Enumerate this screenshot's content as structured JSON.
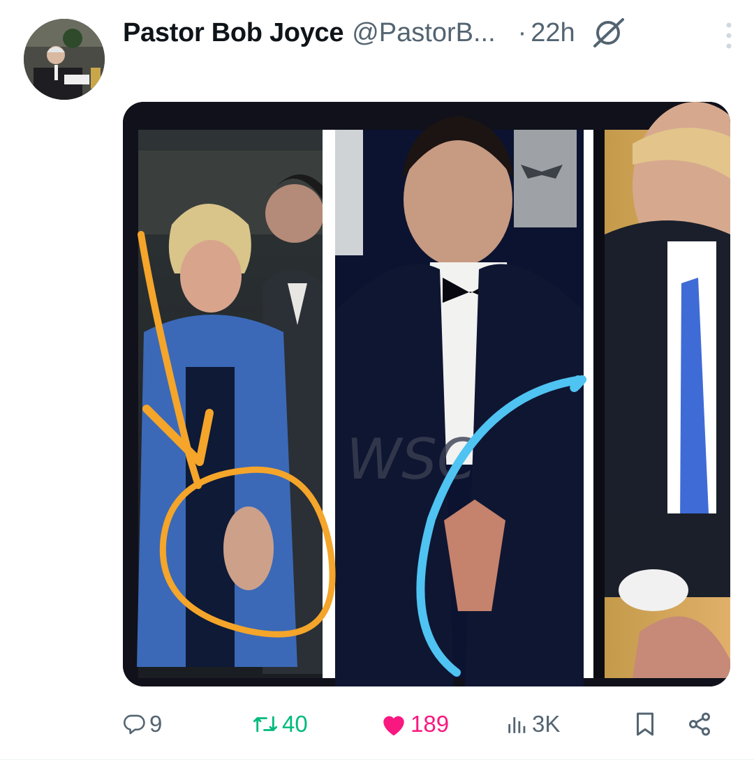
{
  "tweet": {
    "author_name": "Pastor Bob Joyce",
    "author_handle": "@PastorB...",
    "separator": "·",
    "time": "22h",
    "icons": {
      "avatar": "avatar",
      "grok": "grok-icon",
      "more": "more-options-icon"
    }
  },
  "media": {
    "panels": [
      "left-panel-orange-circle",
      "center-panel-blue-circle",
      "right-panel"
    ],
    "watermark": "WSC...m",
    "annotation_colors": {
      "orange": "#f4a52a",
      "blue": "#4fc3f2"
    }
  },
  "actions": {
    "reply_count": "9",
    "retweet_count": "40",
    "like_count": "189",
    "view_count": "3K",
    "colors": {
      "retweet": "#00ba7c",
      "like": "#f91880",
      "default": "#536471"
    }
  }
}
